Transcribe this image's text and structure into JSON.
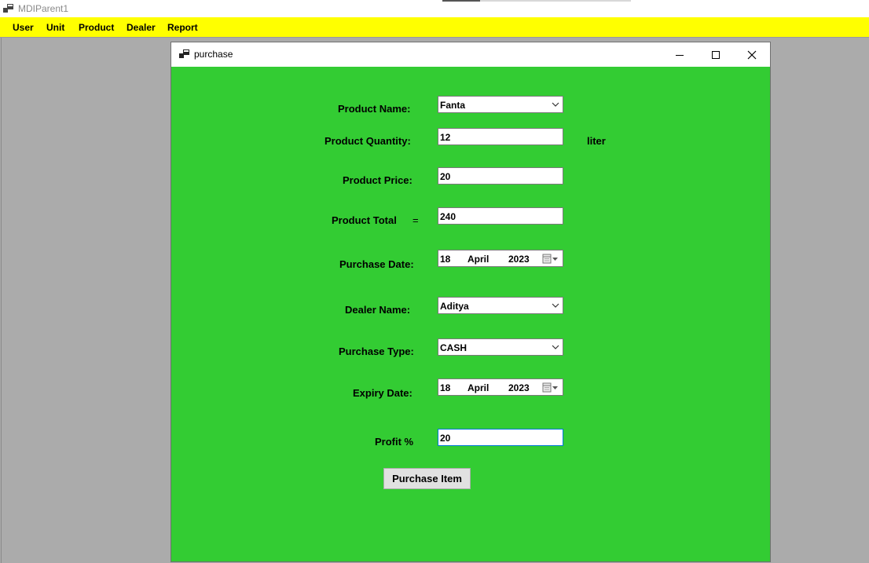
{
  "app": {
    "title": "MDIParent1"
  },
  "menu": {
    "items": [
      "User",
      "Unit",
      "Product",
      "Dealer",
      "Report"
    ]
  },
  "window": {
    "title": "purchase"
  },
  "form": {
    "product_name_label": "Product Name:",
    "product_name_value": "Fanta",
    "product_quantity_label": "Product Quantity:",
    "product_quantity_value": "12",
    "unit_label": "liter",
    "product_price_label": "Product Price:",
    "product_price_value": "20",
    "product_total_label": "Product Total",
    "equals_sign": "=",
    "product_total_value": "240",
    "purchase_date_label": "Purchase Date:",
    "purchase_date": {
      "day": "18",
      "month": "April",
      "year": "2023"
    },
    "dealer_name_label": "Dealer Name:",
    "dealer_name_value": "Aditya",
    "purchase_type_label": "Purchase Type:",
    "purchase_type_value": "CASH",
    "expiry_date_label": "Expiry Date:",
    "expiry_date": {
      "day": "18",
      "month": "April",
      "year": "2023"
    },
    "profit_label": "Profit %",
    "profit_value": "20",
    "submit_label": "Purchase Item"
  },
  "colors": {
    "menu_bar": "#ffff00",
    "form_background": "#33cc33",
    "mdi_background": "#ababab"
  }
}
